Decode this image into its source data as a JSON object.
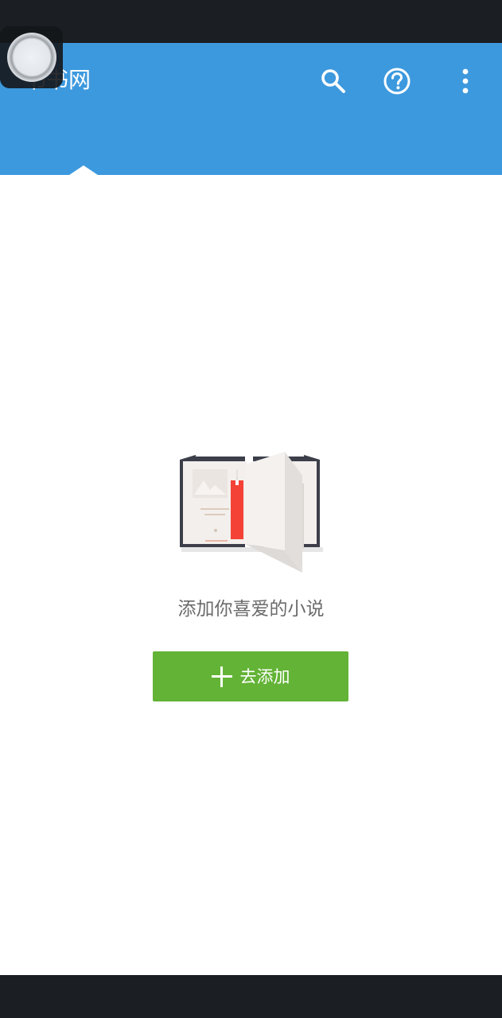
{
  "app_bar": {
    "title": "书书网",
    "background_color": "#3d99de",
    "actions": [
      {
        "name": "search-icon"
      },
      {
        "name": "help-icon"
      },
      {
        "name": "more-vert-icon"
      }
    ]
  },
  "empty_state": {
    "illustration": "open-book-icon",
    "message": "添加你喜爱的小说",
    "add_button": {
      "label": "去添加",
      "icon": "plus-icon",
      "color": "#63b336"
    }
  },
  "colors": {
    "status_bar": "#1b1e22",
    "nav_bar": "#1b1e22",
    "text_muted": "#6b6b6b",
    "bookmark": "#f44236"
  }
}
